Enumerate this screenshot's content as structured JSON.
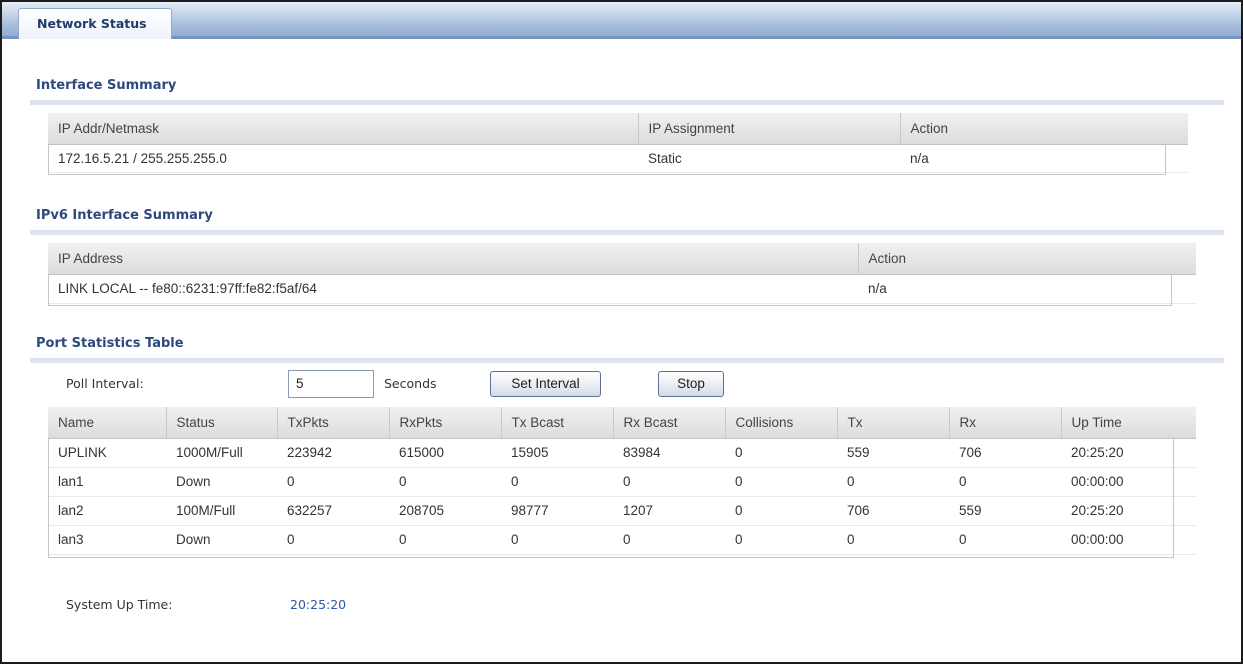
{
  "tab": {
    "label": "Network Status"
  },
  "interface_summary": {
    "title": "Interface Summary",
    "columns": [
      "IP Addr/Netmask",
      "IP Assignment",
      "Action"
    ],
    "rows": [
      [
        "172.16.5.21 / 255.255.255.0",
        "Static",
        "n/a"
      ]
    ]
  },
  "ipv6_summary": {
    "title": "IPv6 Interface Summary",
    "columns": [
      "IP Address",
      "Action"
    ],
    "rows": [
      [
        "LINK LOCAL -- fe80::6231:97ff:fe82:f5af/64",
        "n/a"
      ]
    ]
  },
  "port_stats": {
    "title": "Port Statistics Table",
    "poll_interval_label": "Poll Interval:",
    "poll_interval_value": "5",
    "seconds_label": "Seconds",
    "set_interval_label": "Set Interval",
    "stop_label": "Stop",
    "columns": [
      "Name",
      "Status",
      "TxPkts",
      "RxPkts",
      "Tx Bcast",
      "Rx Bcast",
      "Collisions",
      "Tx",
      "Rx",
      "Up Time"
    ],
    "rows": [
      [
        "UPLINK",
        "1000M/Full",
        "223942",
        "615000",
        "15905",
        "83984",
        "0",
        "559",
        "706",
        "20:25:20"
      ],
      [
        "lan1",
        "Down",
        "0",
        "0",
        "0",
        "0",
        "0",
        "0",
        "0",
        "00:00:00"
      ],
      [
        "lan2",
        "100M/Full",
        "632257",
        "208705",
        "98777",
        "1207",
        "0",
        "706",
        "559",
        "20:25:20"
      ],
      [
        "lan3",
        "Down",
        "0",
        "0",
        "0",
        "0",
        "0",
        "0",
        "0",
        "00:00:00"
      ]
    ],
    "system_up_time_label": "System Up Time:",
    "system_up_time_value": "20:25:20"
  },
  "colors": {
    "title": "#2c4a7c",
    "link_value": "#2a5aa7",
    "tab_bar": "#8ea8cd"
  }
}
